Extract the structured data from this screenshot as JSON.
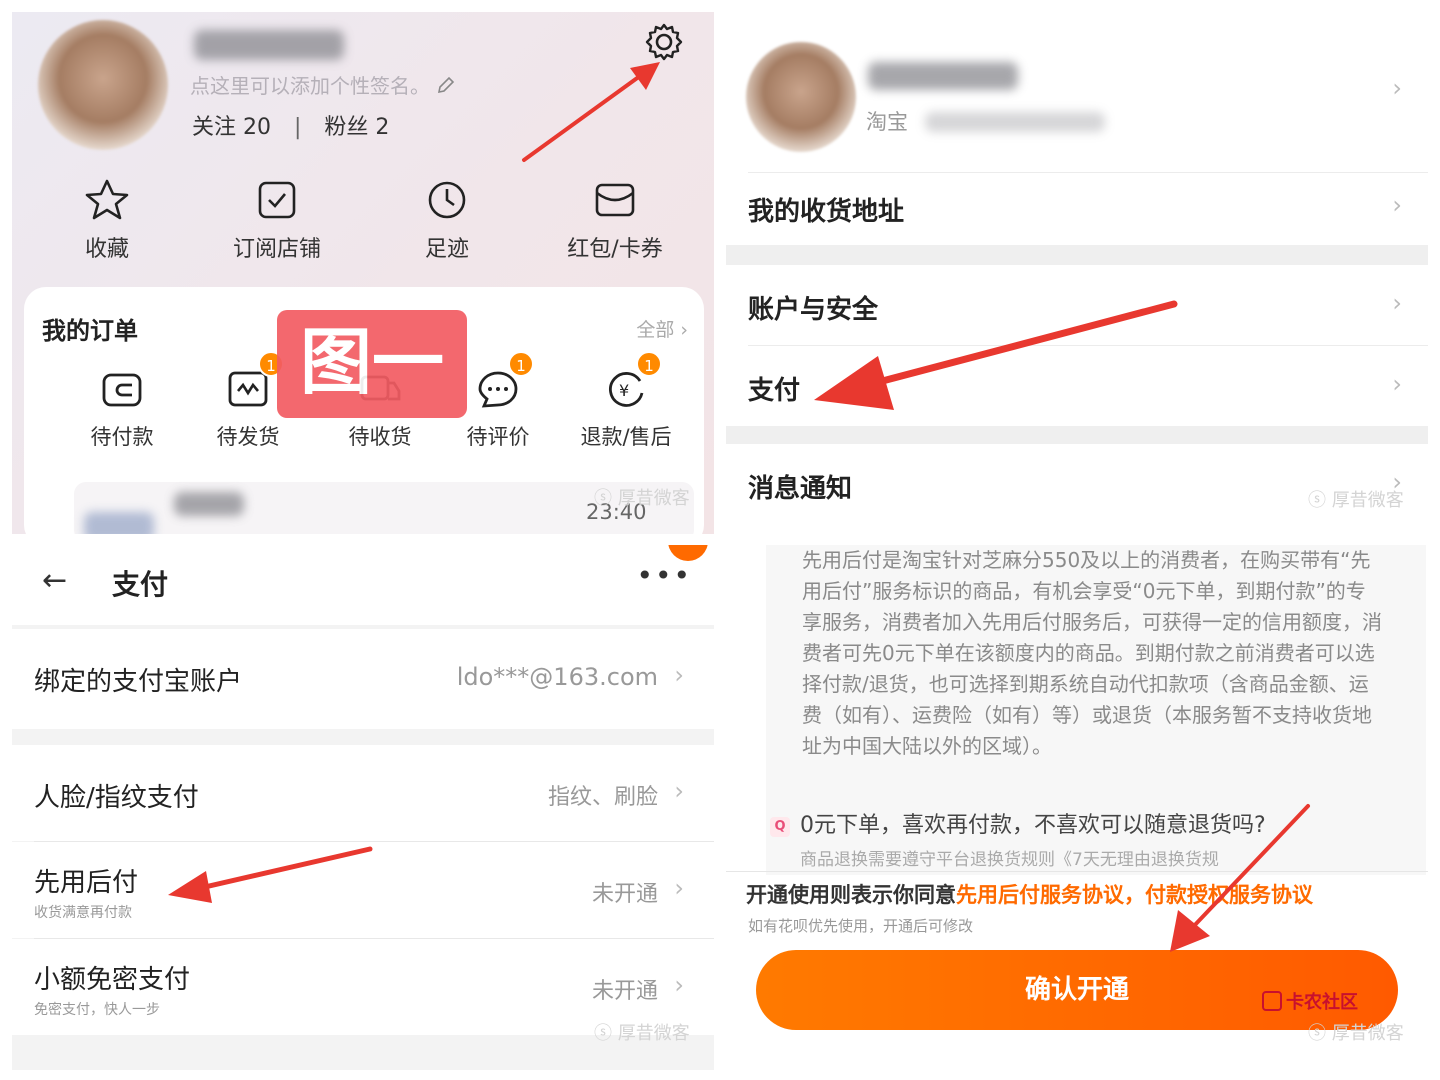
{
  "profile": {
    "signature_hint": "点这里可以添加个性签名。",
    "follow_label": "关注 20",
    "fans_label": "粉丝 2",
    "separator": "|",
    "shortcuts": [
      {
        "label": "收藏",
        "icon": "star-icon"
      },
      {
        "label": "订阅店铺",
        "icon": "store-check-icon"
      },
      {
        "label": "足迹",
        "icon": "clock-icon"
      },
      {
        "label": "红包/卡券",
        "icon": "coupon-icon"
      }
    ],
    "orders": {
      "title": "我的订单",
      "all_label": "全部 ›",
      "items": [
        {
          "label": "待付款",
          "badge": ""
        },
        {
          "label": "待发货",
          "badge": "1"
        },
        {
          "label": "待收货",
          "badge": ""
        },
        {
          "label": "待评价",
          "badge": "1"
        },
        {
          "label": "退款/售后",
          "badge": "1"
        }
      ],
      "time": "23:40"
    },
    "stamp_text": "图一",
    "watermark": "ⓢ 厚昔微客"
  },
  "settings": {
    "taobao_label": "淘宝",
    "rows": [
      "我的收货地址",
      "账户与安全",
      "支付",
      "消息通知"
    ],
    "chevron": "›",
    "watermark": "ⓢ 厚昔微客"
  },
  "pay": {
    "back_glyph": "←",
    "title": "支付",
    "more_glyph": "•••",
    "rows": [
      {
        "title": "绑定的支付宝账户",
        "sub": "",
        "value": "ldo***@163.com"
      },
      {
        "title": "人脸/指纹支付",
        "sub": "",
        "value": "指纹、刷脸"
      },
      {
        "title": "先用后付",
        "sub": "收货满意再付款",
        "value": "未开通"
      },
      {
        "title": "小额免密支付",
        "sub": "免密支付，快人一步",
        "value": "未开通"
      }
    ],
    "chevron": "›",
    "watermark": "ⓢ 厚昔微客"
  },
  "agreement": {
    "paragraph": "先用后付是淘宝针对芝麻分550及以上的消费者，在购买带有“先用后付”服务标识的商品，有机会享受“0元下单，到期付款”的专享服务，消费者加入先用后付服务后，可获得一定的信用额度，消费者可先0元下单在该额度内的商品。到期付款之前消费者可以选择付款/退货，也可选择到期系统自动代扣款项（含商品金额、运费（如有）、运费险（如有）等）或退货（本服务暂不支持收货地址为中国大陆以外的区域）。",
    "q_mark": "Q",
    "question": "0元下单，喜欢再付款，不喜欢可以随意退货吗?",
    "cut_line": "商品退换需要遵守平台退换货规则《7天无理由退换货规",
    "agree_prefix": "开通使用则表示你同意",
    "agree_link": "先用后付服务协议，付款授权服务协议",
    "agree_sub": "如有花呗优先使用，开通后可修改",
    "confirm_label": "确认开通",
    "logo_text": "卡农社区",
    "watermark": "ⓢ 厚昔微客"
  },
  "colors": {
    "accent_orange": "#ff6a00",
    "arrow_red": "#e8382f",
    "stamp_red": "#f25c62"
  }
}
